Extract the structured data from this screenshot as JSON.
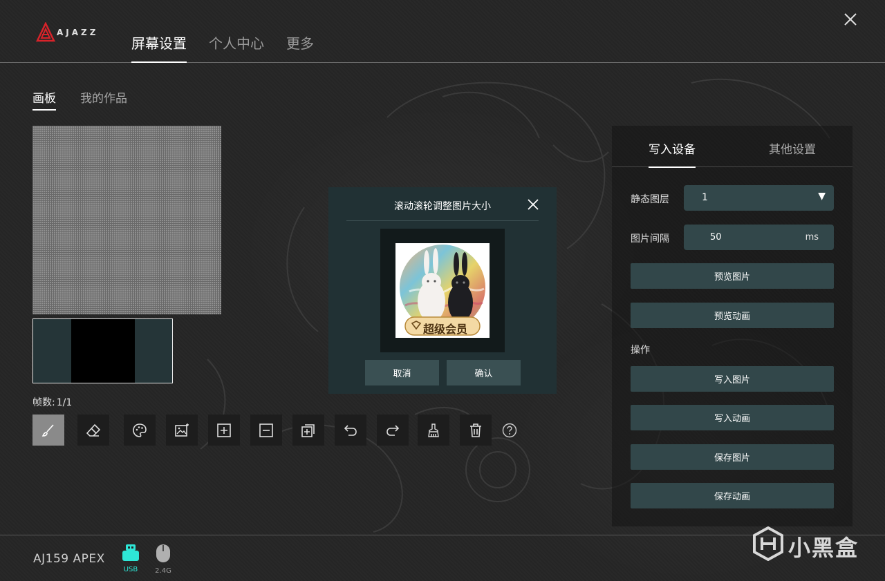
{
  "header": {
    "brand": "AJAZZ",
    "tabs": [
      {
        "label": "屏幕设置",
        "active": true
      },
      {
        "label": "个人中心",
        "active": false
      },
      {
        "label": "更多",
        "active": false
      }
    ]
  },
  "subtabs": [
    {
      "label": "画板",
      "active": true
    },
    {
      "label": "我的作品",
      "active": false
    }
  ],
  "frames": {
    "label": "帧数:",
    "value": "1/1"
  },
  "toolbar": {
    "tools": [
      "brush-icon",
      "eraser-icon",
      "palette-icon",
      "image-import-icon",
      "add-frame-icon",
      "remove-frame-icon",
      "duplicate-frame-icon",
      "undo-icon",
      "redo-icon",
      "clear-brush-icon",
      "trash-icon",
      "help-icon"
    ]
  },
  "dialog": {
    "title": "滚动滚轮调整图片大小",
    "badge_text": "超级会员",
    "cancel_label": "取消",
    "confirm_label": "确认"
  },
  "panel": {
    "tabs": [
      {
        "label": "写入设备",
        "active": true
      },
      {
        "label": "其他设置",
        "active": false
      }
    ],
    "static_layer_label": "静态图层",
    "static_layer_value": "1",
    "interval_label": "图片间隔",
    "interval_value": "50",
    "interval_unit": "ms",
    "preview_image_label": "预览图片",
    "preview_animation_label": "预览动画",
    "operations_label": "操作",
    "write_image_label": "写入图片",
    "write_animation_label": "写入动画",
    "save_image_label": "保存图片",
    "save_animation_label": "保存动画"
  },
  "footer": {
    "device_name": "AJ159 APEX",
    "usb_label": "USB",
    "wireless_label": "2.4G"
  },
  "watermark": {
    "text": "小黑盒"
  },
  "colors": {
    "background": "#262626",
    "panel_button": "#32474a",
    "dialog": "#213134",
    "usb_active": "#2ee6d6",
    "logo_red": "#d8232a"
  }
}
